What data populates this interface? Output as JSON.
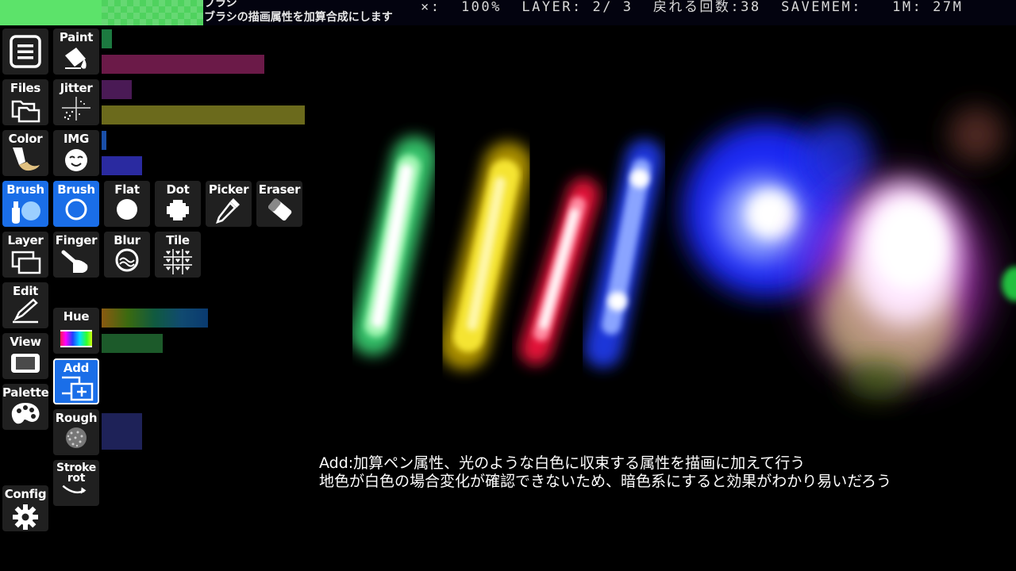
{
  "status_bar": {
    "tool_name": "ブラシ",
    "tool_description": "ブラシの描画属性を加算合成にします",
    "status_text": "×:  100%  LAYER: 2/ 3  戻れる回数:38  SAVEMEM:   1M: 27M",
    "current_color": "#5ce36a"
  },
  "left_column": [
    {
      "name": "menu",
      "label": "",
      "icon": "hamburger-menu-icon"
    },
    {
      "name": "files",
      "label": "Files",
      "icon": "folder-icon"
    },
    {
      "name": "color",
      "label": "Color",
      "icon": "paint-tube-icon"
    },
    {
      "name": "brush",
      "label": "Brush",
      "icon": "brush-icon",
      "active": true
    },
    {
      "name": "layer",
      "label": "Layer",
      "icon": "layers-icon"
    },
    {
      "name": "edit",
      "label": "Edit",
      "icon": "pen-edit-icon"
    },
    {
      "name": "view",
      "label": "View",
      "icon": "tablet-view-icon"
    },
    {
      "name": "palette",
      "label": "Palette",
      "icon": "palette-icon"
    },
    {
      "name": "config",
      "label": "Config",
      "icon": "gear-icon"
    }
  ],
  "brush_options": {
    "paint": {
      "label": "Paint",
      "icon": "paint-bucket-icon"
    },
    "jitter": {
      "label": "Jitter",
      "icon": "jitter-icon"
    },
    "img": {
      "label": "IMG",
      "icon": "face-stamp-icon"
    },
    "hue": {
      "label": "Hue",
      "icon": "rainbow-hue-icon"
    },
    "add": {
      "label": "Add",
      "icon": "add-blend-icon",
      "active": true
    },
    "rough": {
      "label": "Rough",
      "icon": "rough-texture-icon"
    },
    "stroke_rot": {
      "label": "Stroke rot",
      "icon": "stroke-rotate-icon"
    }
  },
  "brush_types": [
    {
      "name": "brush",
      "label": "Brush",
      "icon": "round-brush-icon",
      "active": true
    },
    {
      "name": "flat",
      "label": "Flat",
      "icon": "flat-circle-icon"
    },
    {
      "name": "dot",
      "label": "Dot",
      "icon": "dot-icon"
    },
    {
      "name": "picker",
      "label": "Picker",
      "icon": "eyedropper-icon"
    },
    {
      "name": "eraser",
      "label": "Eraser",
      "icon": "eraser-icon"
    }
  ],
  "extra_tools": [
    {
      "name": "finger",
      "label": "Finger",
      "icon": "finger-smudge-icon"
    },
    {
      "name": "blur",
      "label": "Blur",
      "icon": "blur-icon"
    },
    {
      "name": "tile",
      "label": "Tile",
      "icon": "tile-pattern-icon"
    }
  ],
  "sliders": [
    {
      "name": "size",
      "color": "#1c7a40",
      "value": 0.02
    },
    {
      "name": "alpha",
      "color": "#6b1a48",
      "value": 0.32
    },
    {
      "name": "jitter-amount",
      "color": "#4a1a55",
      "value": 0.06
    },
    {
      "name": "jitter-spread",
      "color": "#6b6a1c",
      "value": 0.4
    },
    {
      "name": "img-size",
      "color": "#1a4fa8",
      "value": 0.01
    },
    {
      "name": "img-alpha",
      "color": "#2a2aa0",
      "value": 0.08
    },
    {
      "name": "hue-shift",
      "color": "gradient",
      "value": 0.21
    },
    {
      "name": "hue-amount",
      "color": "#1c5a2a",
      "value": 0.12
    },
    {
      "name": "rough-amount",
      "color": "#1e2258",
      "value": 0.08
    }
  ],
  "caption": {
    "line1": "Add:加算ペン属性、光のような白色に収束する属性を描画に加えて行う",
    "line2": "地色が白色の場合変化が確認できないため、暗色系にすると効果がわかり易いだろう"
  }
}
